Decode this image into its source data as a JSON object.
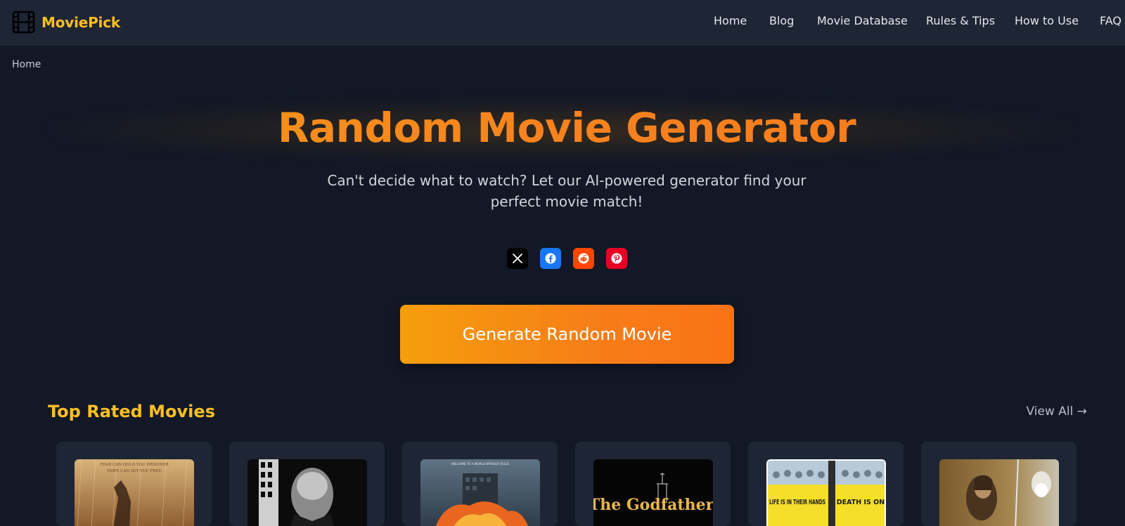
{
  "brand": {
    "name": "MoviePick",
    "icon": "film-icon",
    "color": "#fbbf24"
  },
  "nav": {
    "items": [
      {
        "label": "Home"
      },
      {
        "label": "Blog"
      },
      {
        "label": "Movie Database"
      },
      {
        "label": "Rules & Tips"
      },
      {
        "label": "How to Use"
      },
      {
        "label": "FAQ"
      }
    ]
  },
  "breadcrumb": {
    "current": "Home"
  },
  "hero": {
    "title": "Random Movie Generator",
    "subtitle": "Can't decide what to watch? Let our AI-powered generator find your perfect movie match!",
    "title_color": "#f7831e"
  },
  "share": {
    "buttons": [
      {
        "name": "x-icon",
        "bg": "#000000"
      },
      {
        "name": "facebook-icon",
        "bg": "#1877f2"
      },
      {
        "name": "reddit-icon",
        "bg": "#ff4500"
      },
      {
        "name": "pinterest-icon",
        "bg": "#e60023"
      }
    ]
  },
  "generate_button": {
    "label": "Generate Random Movie",
    "gradient": [
      "#f59e0b",
      "#f97316"
    ]
  },
  "top_rated": {
    "title": "Top Rated Movies",
    "view_all": "View All →",
    "posters": [
      {
        "name": "poster-shawshank",
        "text_top": "FEAR CAN HOLD YOU PRISONER",
        "text_bottom": "HOPE CAN SET YOU FREE"
      },
      {
        "name": "poster-godfather-brando"
      },
      {
        "name": "poster-dark-knight",
        "text_top": "WELCOME TO A WORLD WITHOUT RULES"
      },
      {
        "name": "poster-godfather",
        "text_top": "The Godfather"
      },
      {
        "name": "poster-12-angry-men",
        "text_top": "LIFE IS IN THEIR HANDS",
        "text_bottom": "DEATH IS ON"
      },
      {
        "name": "poster-return-of-the-king"
      }
    ]
  },
  "colors": {
    "background": "#121826",
    "navbar": "#1e2535",
    "accent": "#fbbf24",
    "card": "#1e2535"
  }
}
